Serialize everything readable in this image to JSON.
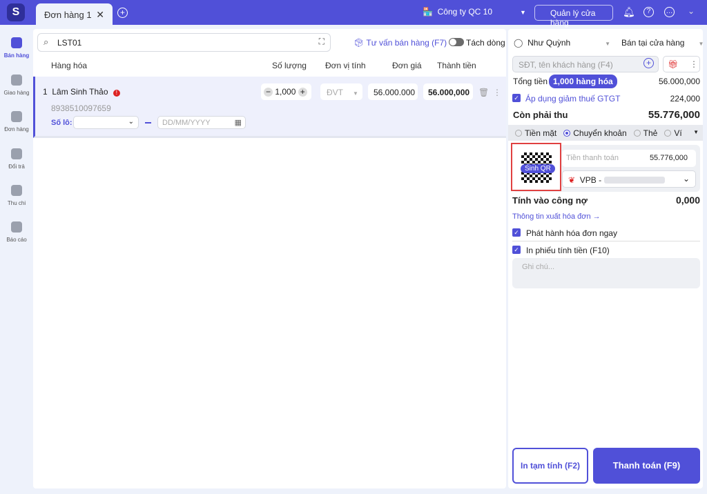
{
  "header": {
    "tab_label": "Đơn hàng",
    "tab_number": "1",
    "company": "Công ty QC 10",
    "store_manage": "Quản lý cửa hàng"
  },
  "sidebar": [
    {
      "label": "Bán hàng"
    },
    {
      "label": "Giao hàng"
    },
    {
      "label": "Đơn hàng"
    },
    {
      "label": "Đổi trả"
    },
    {
      "label": "Thu chi"
    },
    {
      "label": "Báo cáo"
    }
  ],
  "search": {
    "value": "LST01"
  },
  "toolbar": {
    "advise": "Tư vấn bán hàng (F7)",
    "split": "Tách dòng"
  },
  "columns": [
    "Hàng hóa",
    "Số lượng",
    "Đơn vị tính",
    "Đơn giá",
    "Thành tiền"
  ],
  "item": {
    "index": "1",
    "name": "Lâm Sinh Thảo",
    "barcode": "8938510097659",
    "quantity": "1,000",
    "unit_placeholder": "ĐVT",
    "price": "56.000.000",
    "total": "56.000,000",
    "lot_label": "Số lô:",
    "date_placeholder": "DD/MM/YYYY"
  },
  "order": {
    "staff": "Như Quỳnh",
    "channel": "Bán tại cửa hàng",
    "customer_placeholder": "SĐT, tên khách hàng (F4)",
    "total_label": "Tổng tiền",
    "items_badge": "1,000 hàng hóa",
    "total": "56.000,000",
    "vat_label": "Áp dụng giảm thuế GTGT",
    "vat": "224,000",
    "due_label": "Còn phải thu",
    "due": "55.776,000"
  },
  "payment": {
    "methods": [
      "Tiền mặt",
      "Chuyển khoản",
      "Thẻ",
      "Ví"
    ],
    "qr_label": "Sinh QR",
    "amount_label": "Tiền thanh toán",
    "amount": "55.776,000",
    "bank": "VPB -",
    "debt_label": "Tính vào công nợ",
    "debt": "0,000",
    "invoice_link": "Thông tin xuất hóa đơn →",
    "issue_invoice": "Phát hành hóa đơn ngay",
    "print_receipt": "In phiếu tính tiền (F10)",
    "note_placeholder": "Ghi chú..."
  },
  "actions": {
    "print_temp": "In tạm tính (F2)",
    "pay": "Thanh toán (F9)"
  }
}
